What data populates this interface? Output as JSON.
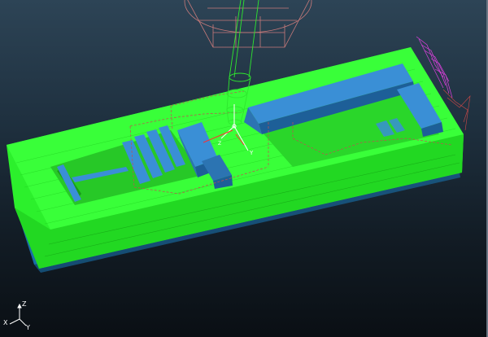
{
  "colors": {
    "background_top": "#2d4456",
    "background_bottom": "#0a0f14",
    "toolpath": "#33ff33",
    "stock_side": "#1a78b8",
    "part_feature": "#3a8fd6",
    "fixture_wire": "#c05050",
    "spindle_wire": "#c87a7a",
    "tool_wire": "#2ee82e",
    "tool_vector_red": "#ff3030",
    "magenta_paths": "#e040e0",
    "triad": "#ffffff"
  },
  "scene": {
    "spindle_head": "spindle-head",
    "tool": "cutting-tool",
    "workpiece": "milled-block",
    "toolpath": "green-toolpath"
  },
  "axis_triad": {
    "z_label": "Z",
    "y_label": "Y",
    "x_label": "X"
  },
  "tool_triad": {
    "y_label": "Y",
    "z_label": "Z"
  }
}
